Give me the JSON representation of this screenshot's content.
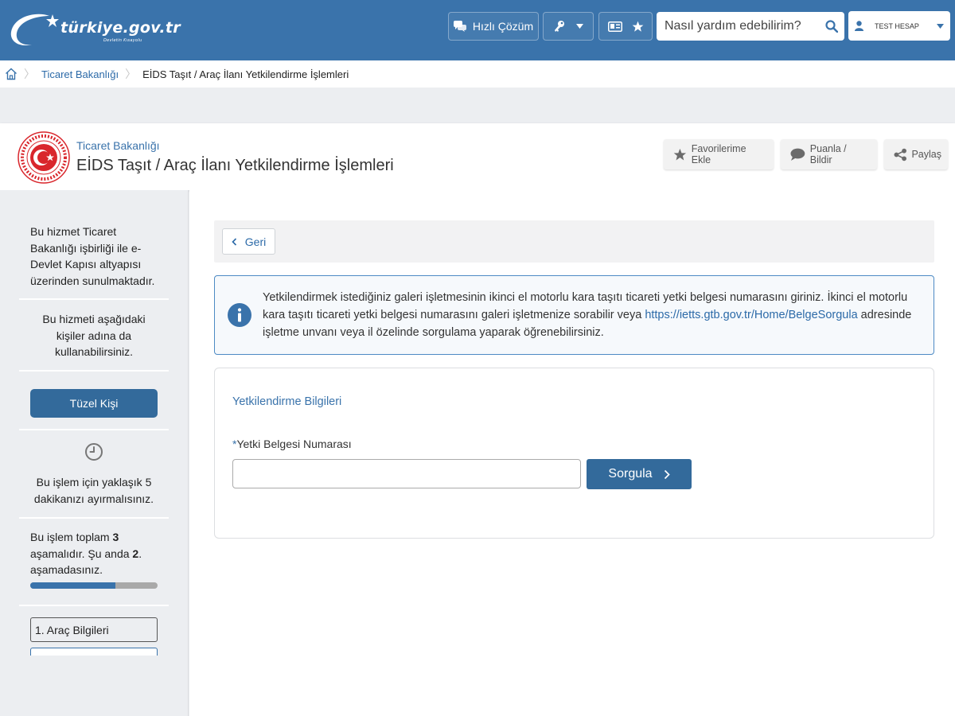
{
  "topbar": {
    "logo_text": "türkiye.gov.tr",
    "logo_sub": "Devletin Kısayolu",
    "quick_solution": "Hızlı Çözüm",
    "search_placeholder": "Nasıl yardım edebilirim?",
    "account_label": "TEST HESAP",
    "bg_color": "#3a73ab"
  },
  "breadcrumb": {
    "items": [
      "Ticaret Bakanlığı",
      "EİDS Taşıt / Araç İlanı Yetkilendirme İşlemleri"
    ]
  },
  "header": {
    "ministry": "Ticaret Bakanlığı",
    "title": "EİDS Taşıt / Araç İlanı Yetkilendirme İşlemleri",
    "fav_label": "Favorilerime Ekle",
    "rate_label": "Puanla / Bildir",
    "share_label": "Paylaş"
  },
  "sidebar": {
    "cooperation_text": "Bu hizmet Ticaret Bakanlığı işbirliği ile e-Devlet Kapısı altyapısı üzerinden sunulmaktadır.",
    "behalf_text": "Bu hizmeti aşağıdaki kişiler adına da kullanabilirsiniz.",
    "tuzel_label": "Tüzel Kişi",
    "time_text": "Bu işlem için yaklaşık 5 dakikanızı ayırmalısınız.",
    "steps_text_1": "Bu işlem toplam ",
    "steps_total": "3",
    "steps_text_2": " aşamalıdır. Şu anda ",
    "steps_current": "2",
    "steps_text_3": ". aşamadasınız.",
    "progress_fraction": 0.667,
    "step1_label": "1. Araç Bilgileri"
  },
  "main": {
    "back_label": "Geri",
    "info_text_1": "Yetkilendirmek istediğiniz galeri işletmesinin ikinci el motorlu kara taşıtı ticareti yetki belgesi numarasını giriniz. İkinci el motorlu kara taşıtı ticareti yetki belgesi numarasını galeri işletmenize sorabilir veya ",
    "info_link": "https://ietts.gtb.gov.tr/Home/BelgeSorgula",
    "info_text_2": " adresinde işletme unvanı veya il özelinde sorgulama yaparak öğrenebilirsiniz.",
    "form_title": "Yetkilendirme Bilgileri",
    "field_required_mark": "*",
    "field_label": "Yetki Belgesi Numarası",
    "field_value": "",
    "submit_label": "Sorgula",
    "accent_color": "#336a9b"
  }
}
